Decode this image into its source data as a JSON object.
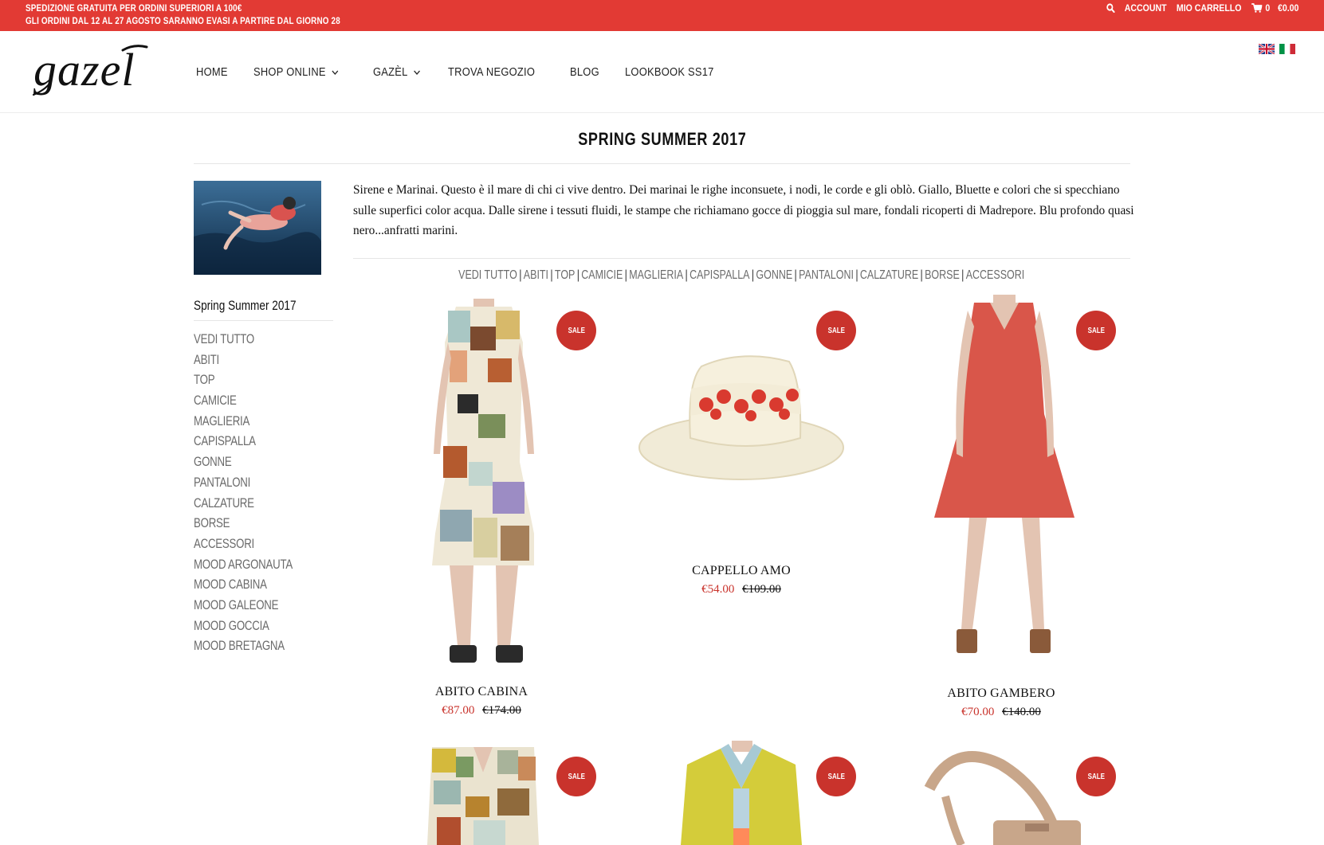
{
  "topbar": {
    "promo_line1": "SPEDIZIONE GRATUITA PER ORDINI SUPERIORI A 100€",
    "promo_line2": "GLI ORDINI DAL 12 AL 27 AGOSTO SARANNO EVASI A PARTIRE DAL GIORNO 28",
    "account": "ACCOUNT",
    "cart": "MIO CARRELLO",
    "cart_count": "0",
    "cart_total": "€0.00",
    "bg_color": "#e23a34"
  },
  "brand": {
    "logo_text": "gazèl"
  },
  "nav": {
    "items": [
      {
        "label": "HOME",
        "has_dropdown": false
      },
      {
        "label": "SHOP ONLINE",
        "has_dropdown": true
      },
      {
        "label": "GAZÈL",
        "has_dropdown": true
      },
      {
        "label": "TROVA NEGOZIO",
        "has_dropdown": false
      },
      {
        "label": "BLOG",
        "has_dropdown": false
      },
      {
        "label": "LOOKBOOK SS17",
        "has_dropdown": false
      }
    ]
  },
  "languages": [
    "en",
    "it"
  ],
  "page": {
    "title": "SPRING SUMMER 2017",
    "intro": "Sirene e Marinai. Questo è il mare di chi ci vive dentro. Dei marinai le righe inconsuete, i nodi, le corde e gli oblò. Giallo, Bluette e colori che si specchiano sulle superfici color acqua. Dalle sirene i tessuti fluidi, le stampe che richiamano gocce di pioggia sul mare, fondali ricoperti di Madrepore. Blu profondo quasi nero...anfratti marini."
  },
  "sidebar": {
    "heading": "Spring Summer 2017",
    "items": [
      "VEDI TUTTO",
      "ABITI",
      "TOP",
      "CAMICIE",
      "MAGLIERIA",
      "CAPISPALLA",
      "GONNE",
      "PANTALONI",
      "CALZATURE",
      "BORSE",
      "ACCESSORI",
      "MOOD ARGONAUTA",
      "MOOD CABINA",
      "MOOD GALEONE",
      "MOOD GOCCIA",
      "MOOD BRETAGNA"
    ]
  },
  "filters": [
    "VEDI TUTTO",
    "ABITI",
    "TOP",
    "CAMICIE",
    "MAGLIERIA",
    "CAPISPALLA",
    "GONNE",
    "PANTALONI",
    "CALZATURE",
    "BORSE",
    "ACCESSORI"
  ],
  "products": [
    {
      "name": "ABITO CABINA",
      "price": "€87.00",
      "original_price": "€174.00",
      "badge": "SALE"
    },
    {
      "name": "CAPPELLO AMO",
      "price": "€54.00",
      "original_price": "€109.00",
      "badge": "SALE"
    },
    {
      "name": "ABITO GAMBERO",
      "price": "€70.00",
      "original_price": "€140.00",
      "badge": "SALE"
    },
    {
      "name": "",
      "price": "",
      "original_price": "",
      "badge": "SALE"
    },
    {
      "name": "",
      "price": "",
      "original_price": "",
      "badge": "SALE"
    },
    {
      "name": "",
      "price": "",
      "original_price": "",
      "badge": "SALE"
    }
  ],
  "colors": {
    "accent": "#e23a34",
    "sale_badge": "#c9332c",
    "muted_text": "#6b6b6b"
  }
}
